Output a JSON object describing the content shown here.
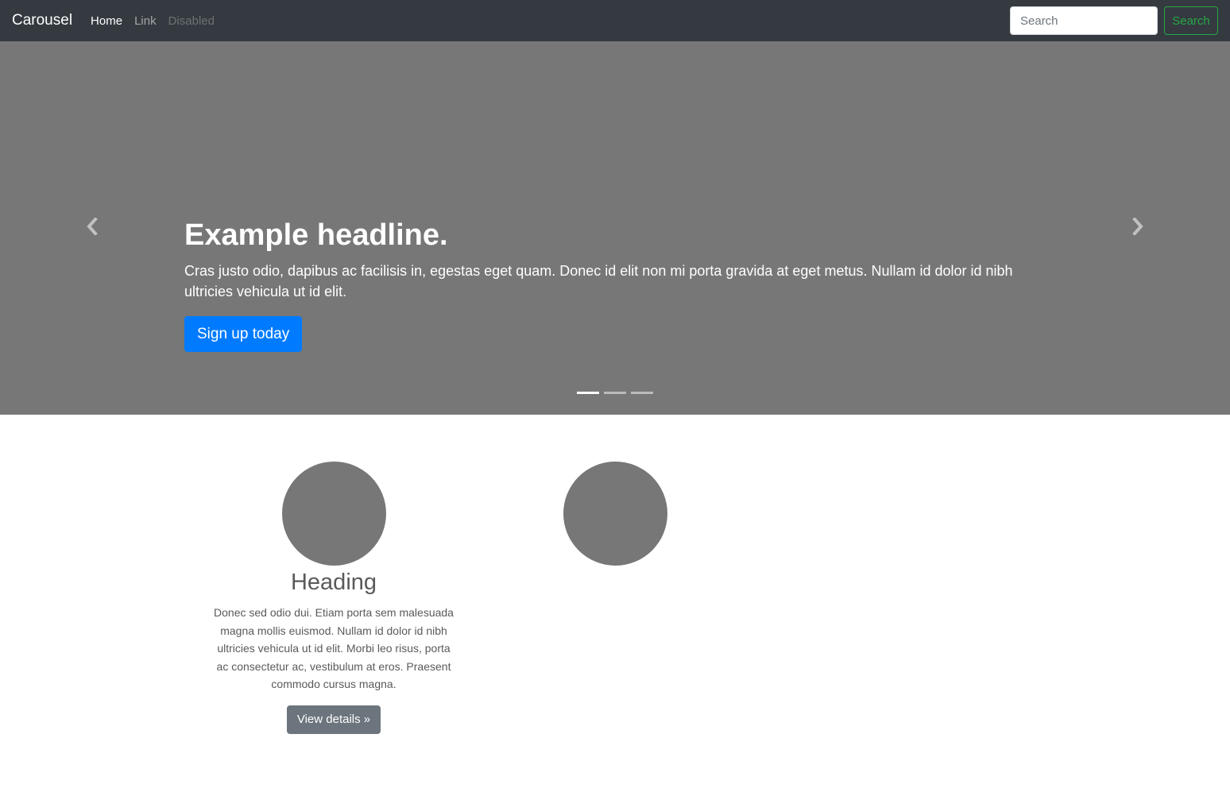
{
  "navbar": {
    "brand": "Carousel",
    "links": [
      {
        "label": "Home",
        "state": "active"
      },
      {
        "label": "Link",
        "state": "normal"
      },
      {
        "label": "Disabled",
        "state": "disabled"
      }
    ],
    "search": {
      "placeholder": "Search",
      "value": "",
      "button_label": "Search"
    }
  },
  "carousel": {
    "background_color": "#777777",
    "slide": {
      "headline": "Example headline.",
      "text": "Cras justo odio, dapibus ac facilisis in, egestas eget quam. Donec id elit non mi porta gravida at eget metus. Nullam id dolor id nibh ultricies vehicula ut id elit.",
      "button_label": "Sign up today"
    },
    "prev_icon": "chevron-left-icon",
    "next_icon": "chevron-right-icon",
    "indicators": {
      "count": 3,
      "active_index": 0
    }
  },
  "marketing": {
    "columns": [
      {
        "heading": "Heading",
        "text": "Donec sed odio dui. Etiam porta sem malesuada magna mollis euismod. Nullam id dolor id nibh ultricies vehicula ut id elit. Morbi leo risus, porta ac consectetur ac, vestibulum at eros. Praesent commodo cursus magna.",
        "button_label": "View details »"
      }
    ]
  },
  "colors": {
    "navbar_bg": "#343a40",
    "primary": "#007bff",
    "success": "#28a745",
    "secondary": "#6c757d",
    "placeholder_gray": "#777777"
  }
}
